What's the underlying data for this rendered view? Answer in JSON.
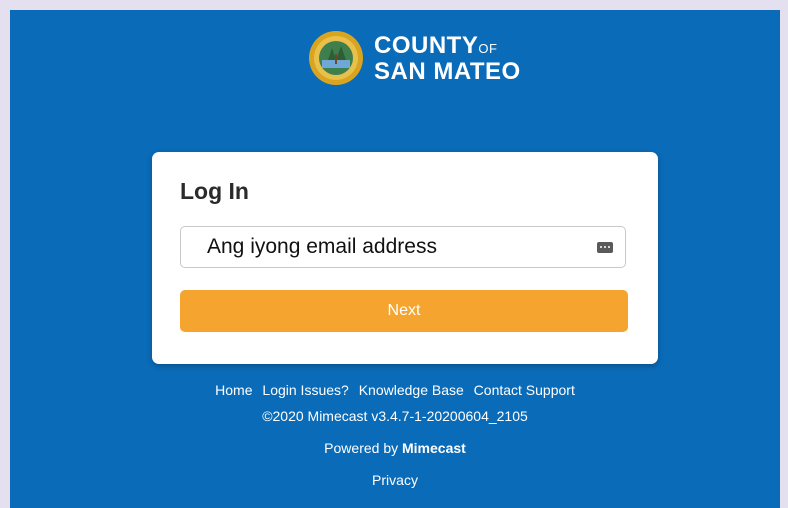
{
  "brand": {
    "line1": "COUNTY",
    "line1_suffix": "OF",
    "line2": "SAN MATEO",
    "seal_icon": "county-seal-icon"
  },
  "login": {
    "title": "Log In",
    "email_value": "Ang iyong email address",
    "next_label": "Next"
  },
  "footer": {
    "links": [
      "Home",
      "Login Issues?",
      "Knowledge Base",
      "Contact Support"
    ],
    "copyright": "©2020 Mimecast v3.4.7-1-20200604_2105",
    "powered_prefix": "Powered by",
    "powered_brand": "Mimecast",
    "privacy": "Privacy"
  },
  "colors": {
    "background": "#0a6bb8",
    "button": "#f5a52f",
    "page_border": "#e4e0f0"
  }
}
